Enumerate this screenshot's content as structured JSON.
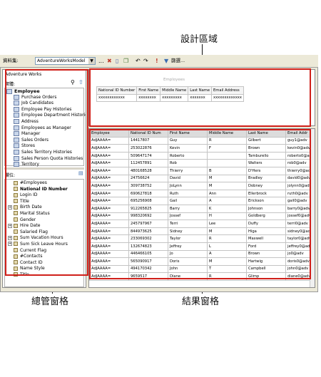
{
  "callouts": {
    "design": "設計區域",
    "commands": "總管窗格",
    "results": "結果窗格"
  },
  "toolbar": {
    "dataset_label": "資料集:",
    "dataset_value": "AdventureWorksModel",
    "ellipsis": "...",
    "filter_label": "篩選..."
  },
  "explorer": {
    "title": "Adventure Works",
    "entities_label": "實體:",
    "root": "Employee",
    "items": [
      "Purchase Orders",
      "Job Candidates",
      "Employee Pay Histories",
      "Employee Department Histories",
      "Address",
      "Employees as Manager",
      "Manager",
      "Sales Orders",
      "Stores",
      "Sales Territory Histories",
      "Sales Person Quota Histories",
      "Territory"
    ],
    "fields_label": "欄位:",
    "fields": [
      {
        "label": "#Employees",
        "bold": false,
        "plus": false
      },
      {
        "label": "National ID Number",
        "bold": true,
        "plus": false
      },
      {
        "label": "Login ID",
        "bold": false,
        "plus": false
      },
      {
        "label": "Title",
        "bold": false,
        "plus": false
      },
      {
        "label": "Birth Date",
        "bold": false,
        "plus": true
      },
      {
        "label": "Marital Status",
        "bold": false,
        "plus": false
      },
      {
        "label": "Gender",
        "bold": false,
        "plus": false
      },
      {
        "label": "Hire Date",
        "bold": false,
        "plus": true
      },
      {
        "label": "Salaried Flag",
        "bold": false,
        "plus": false
      },
      {
        "label": "Sum Vacation Hours",
        "bold": false,
        "plus": true
      },
      {
        "label": "Sum Sick Leave Hours",
        "bold": false,
        "plus": true
      },
      {
        "label": "Current Flag",
        "bold": false,
        "plus": false
      },
      {
        "label": "#Contacts",
        "bold": false,
        "plus": false
      },
      {
        "label": "Contact ID",
        "bold": false,
        "plus": false
      },
      {
        "label": "Name Style",
        "bold": false,
        "plus": false
      },
      {
        "label": "Title",
        "bold": false,
        "plus": false
      }
    ]
  },
  "design": {
    "entity": "Employees",
    "columns": [
      "National ID Number",
      "First Name",
      "Middle Name",
      "Last Name",
      "Email Address"
    ],
    "placeholders": [
      "xxxxxxxxxxxx",
      "xxxxxxxx",
      "xxxxxxxxx",
      "xxxxxxx",
      "xxxxxxxxxxxxx"
    ]
  },
  "results": {
    "columns": [
      "Employee",
      "National ID Num",
      "First Name",
      "Middle Name",
      "Last Name",
      "Email Addr"
    ],
    "rows": [
      [
        "AdJAAAA=",
        "14417807",
        "Guy",
        "R",
        "Gilbert",
        "guy1@adv"
      ],
      [
        "AdJAAAA=",
        "253022876",
        "Kevin",
        "F",
        "Brown",
        "kevin0@adv"
      ],
      [
        "AdJAAAA=",
        "509647174",
        "Roberto",
        "",
        "Tamburello",
        "roberto0@adv"
      ],
      [
        "AdJAAAA=",
        "112457891",
        "Rob",
        "",
        "Walters",
        "rob0@adv"
      ],
      [
        "AdJAAAA=",
        "480168528",
        "Thierry",
        "B",
        "D'Hers",
        "thierry0@adv"
      ],
      [
        "AdJAAAA=",
        "24756624",
        "David",
        "M",
        "Bradley",
        "david0@adv"
      ],
      [
        "AdJAAAA=",
        "309738752",
        "JoLynn",
        "M",
        "Dobney",
        "jolynn0@adv"
      ],
      [
        "AdJAAAA=",
        "690627818",
        "Ruth",
        "Ann",
        "Ellerbrock",
        "ruth0@adv"
      ],
      [
        "AdJAAAA=",
        "695256908",
        "Gail",
        "A",
        "Erickson",
        "gail0@adv"
      ],
      [
        "AdJAAAA=",
        "912265825",
        "Barry",
        "K",
        "Johnson",
        "barry0@adv"
      ],
      [
        "AdJAAAA=",
        "998320692",
        "Jossef",
        "H",
        "Goldberg",
        "jossef0@adv"
      ],
      [
        "AdJAAAA=",
        "245797967",
        "Terri",
        "Lee",
        "Duffy",
        "terri0@adv"
      ],
      [
        "AdJAAAA=",
        "844973625",
        "Sidney",
        "M",
        "Higa",
        "sidney0@adv"
      ],
      [
        "AdJAAAA=",
        "233069302",
        "Taylor",
        "R",
        "Maxwell",
        "taylor0@adv"
      ],
      [
        "AdJAAAA=",
        "132674823",
        "Jeffrey",
        "L",
        "Ford",
        "jeffrey0@adv"
      ],
      [
        "AdJAAAA=",
        "446466105",
        "Jo",
        "A",
        "Brown",
        "jo0@adv"
      ],
      [
        "AdJAAAA=",
        "565090917",
        "Doris",
        "M",
        "Hartwig",
        "doris0@adv"
      ],
      [
        "AdJAAAA=",
        "494170342",
        "John",
        "T",
        "Campbell",
        "john0@adv"
      ],
      [
        "AdJAAAA=",
        "9659517",
        "Diane",
        "R",
        "Glimp",
        "diane0@adv"
      ]
    ]
  }
}
